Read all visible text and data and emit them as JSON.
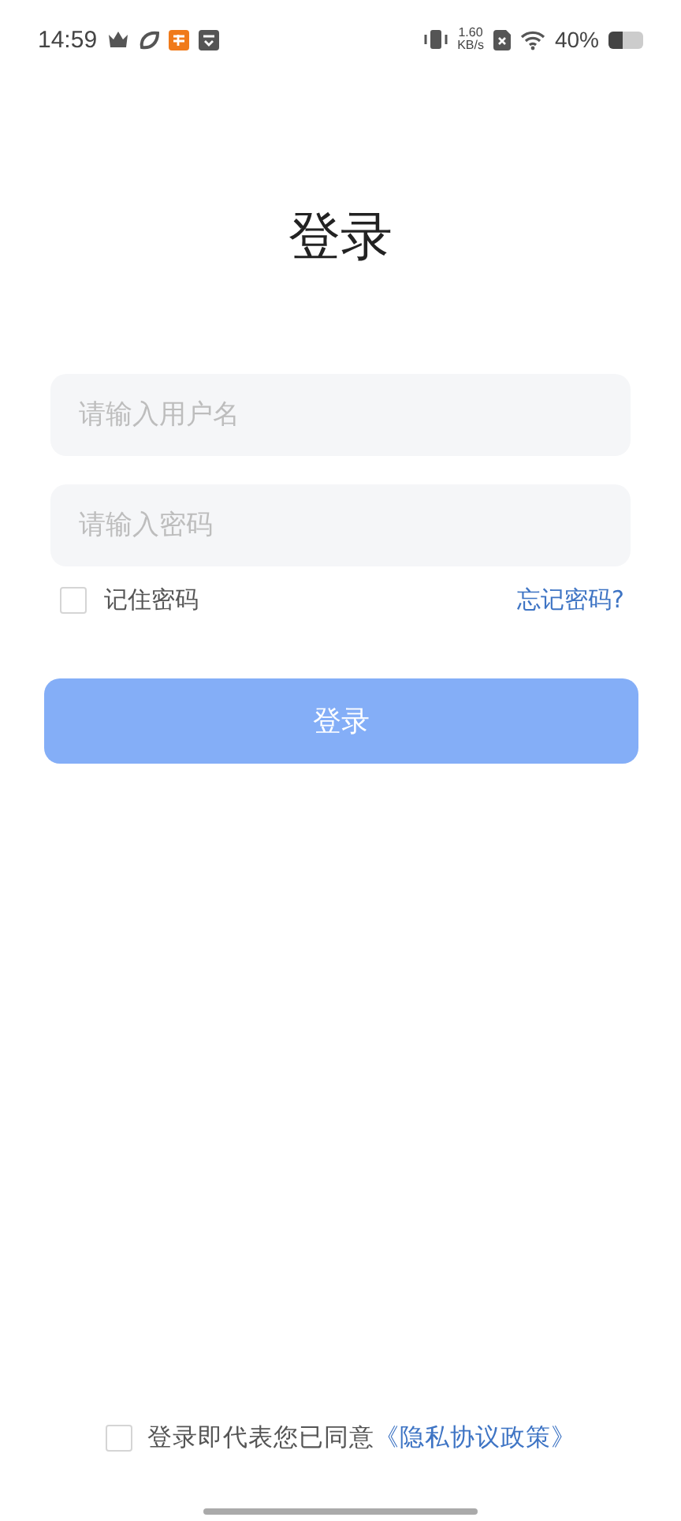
{
  "status_bar": {
    "time": "14:59",
    "net_speed": "1.60",
    "net_unit": "KB/s",
    "battery": "40%"
  },
  "title": "登录",
  "fields": [
    {
      "placeholder": "请输入用户名"
    },
    {
      "placeholder": "请输入密码"
    }
  ],
  "remember": {
    "label": "记住密码",
    "checked": false
  },
  "forgot_link": "忘记密码?",
  "login_button": "登录",
  "agreement": {
    "checked": false,
    "text": "登录即代表您已同意",
    "link": "《隐私协议政策》"
  }
}
